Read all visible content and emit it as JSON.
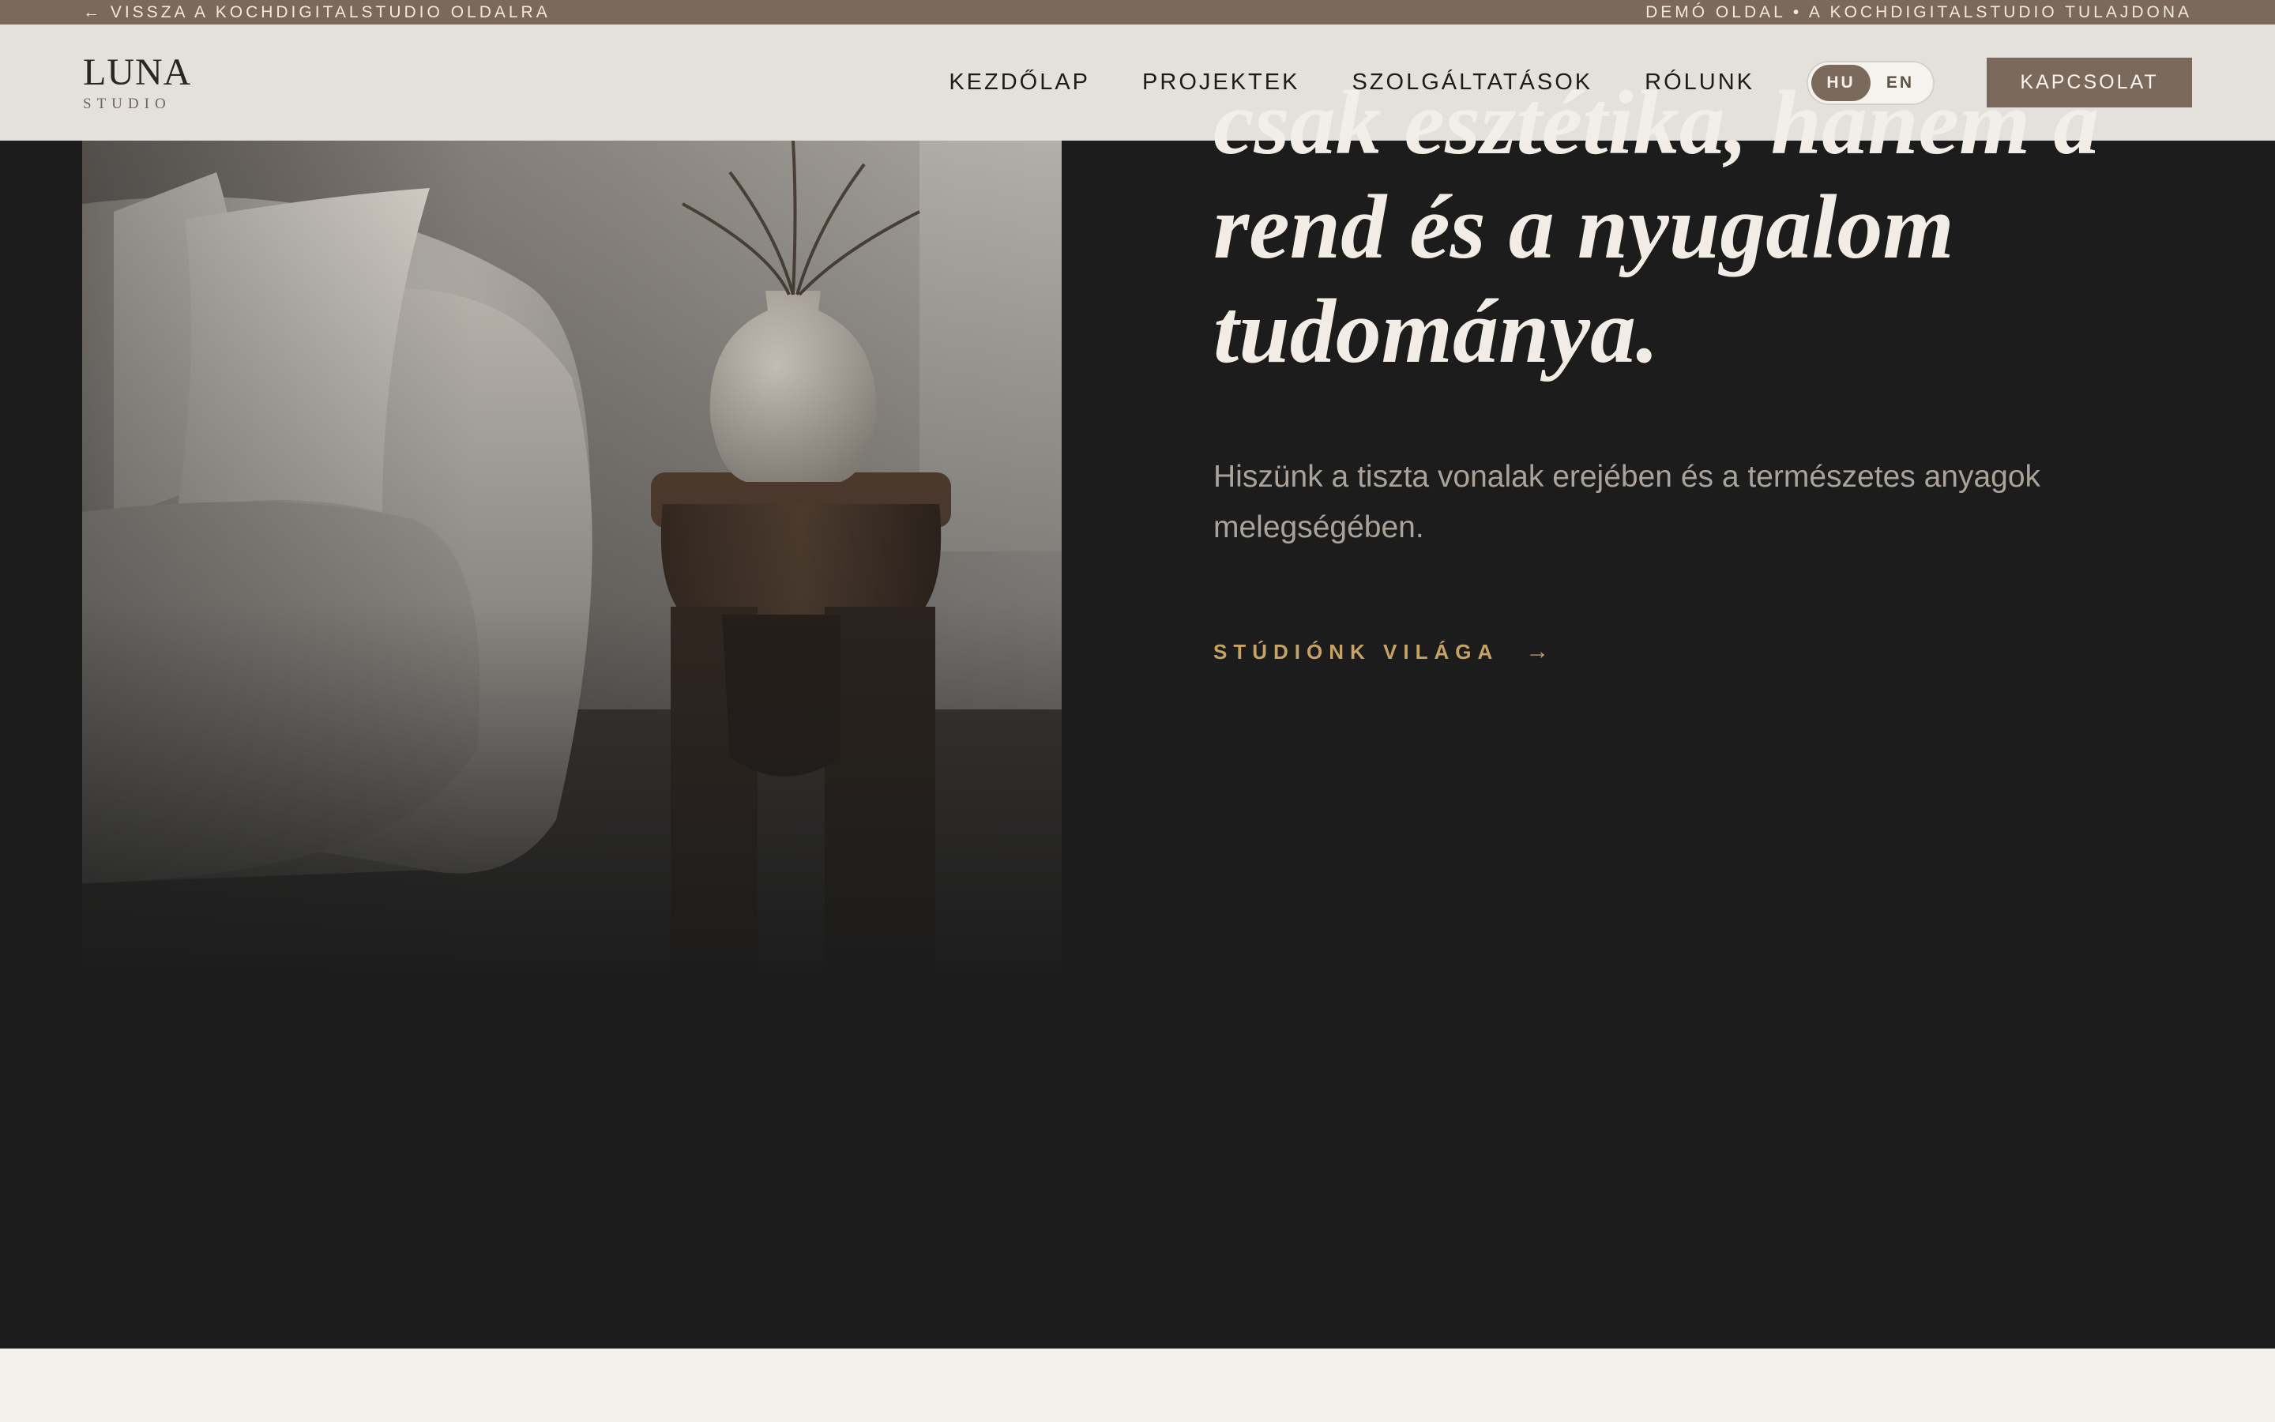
{
  "topbar": {
    "back_link": "← VISSZA A KOCHDIGITALSTUDIO OLDALRA",
    "notice": "DEMÓ OLDAL • A KOCHDIGITALSTUDIO TULAJDONA"
  },
  "header": {
    "logo_main": "LUNA",
    "logo_sub": "STUDIO",
    "nav": [
      "KEZDŐLAP",
      "PROJEKTEK",
      "SZOLGÁLTATÁSOK",
      "RÓLUNK"
    ],
    "lang_options": [
      "HU",
      "EN"
    ],
    "lang_active": "HU",
    "cta_label": "KAPCSOLAT"
  },
  "hero": {
    "headline_line1": "csak esztétika, hanem a",
    "headline_line2": "rend és a nyugalom",
    "headline_line3": "tudománya.",
    "lede": "Hiszünk a tiszta vonalak erejében és a természetes anyagok melegségében.",
    "cta_label": "STÚDIÓNK VILÁGA",
    "cta_arrow": "→"
  },
  "colors": {
    "accent": "#7b6a5c",
    "gold": "#c6a365",
    "dark": "#1c1c1c",
    "cream": "#f3f0eb"
  },
  "icons": {
    "cta_arrow": "arrow-right-icon",
    "back_arrow": "arrow-left-icon"
  }
}
